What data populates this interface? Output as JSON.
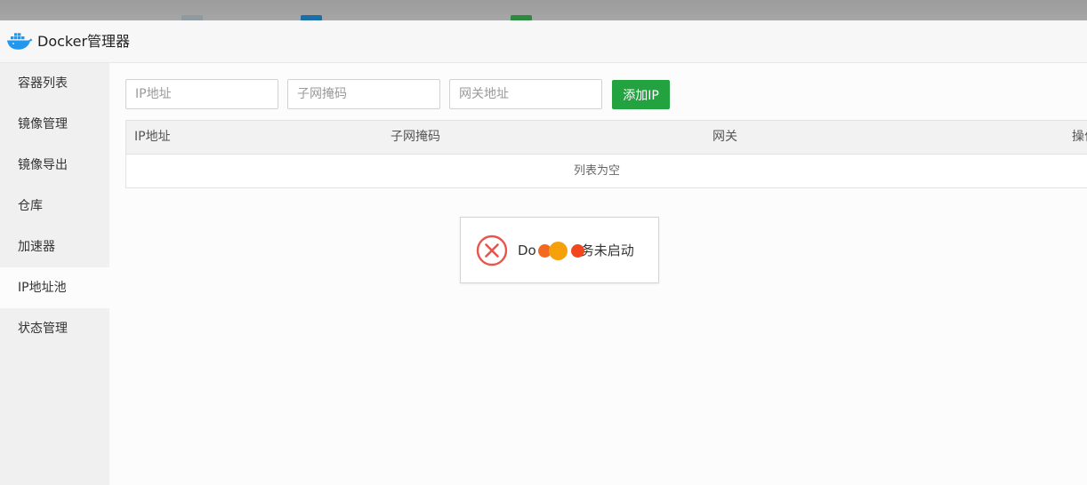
{
  "app": {
    "title": "Docker管理器"
  },
  "sidebar": {
    "items": [
      {
        "label": "容器列表"
      },
      {
        "label": "镜像管理"
      },
      {
        "label": "镜像导出"
      },
      {
        "label": "仓库"
      },
      {
        "label": "加速器"
      },
      {
        "label": "IP地址池"
      },
      {
        "label": "状态管理"
      }
    ],
    "active_index": 5
  },
  "form": {
    "ip_placeholder": "IP地址",
    "subnet_placeholder": "子网掩码",
    "gateway_placeholder": "网关地址",
    "ip_value": "",
    "subnet_value": "",
    "gateway_value": "",
    "add_button_label": "添加IP"
  },
  "table": {
    "columns": [
      "IP地址",
      "子网掩码",
      "网关",
      "操作"
    ],
    "empty_text": "列表为空",
    "rows": []
  },
  "toast": {
    "message_prefix": "Do",
    "message_suffix": "务未启动",
    "icon": "error-circle-icon"
  },
  "colors": {
    "accent_green": "#23a33f",
    "error_red": "#e8554a",
    "logo_blue": "#2396ed"
  },
  "icons": {
    "logo": "docker-whale-icon"
  }
}
